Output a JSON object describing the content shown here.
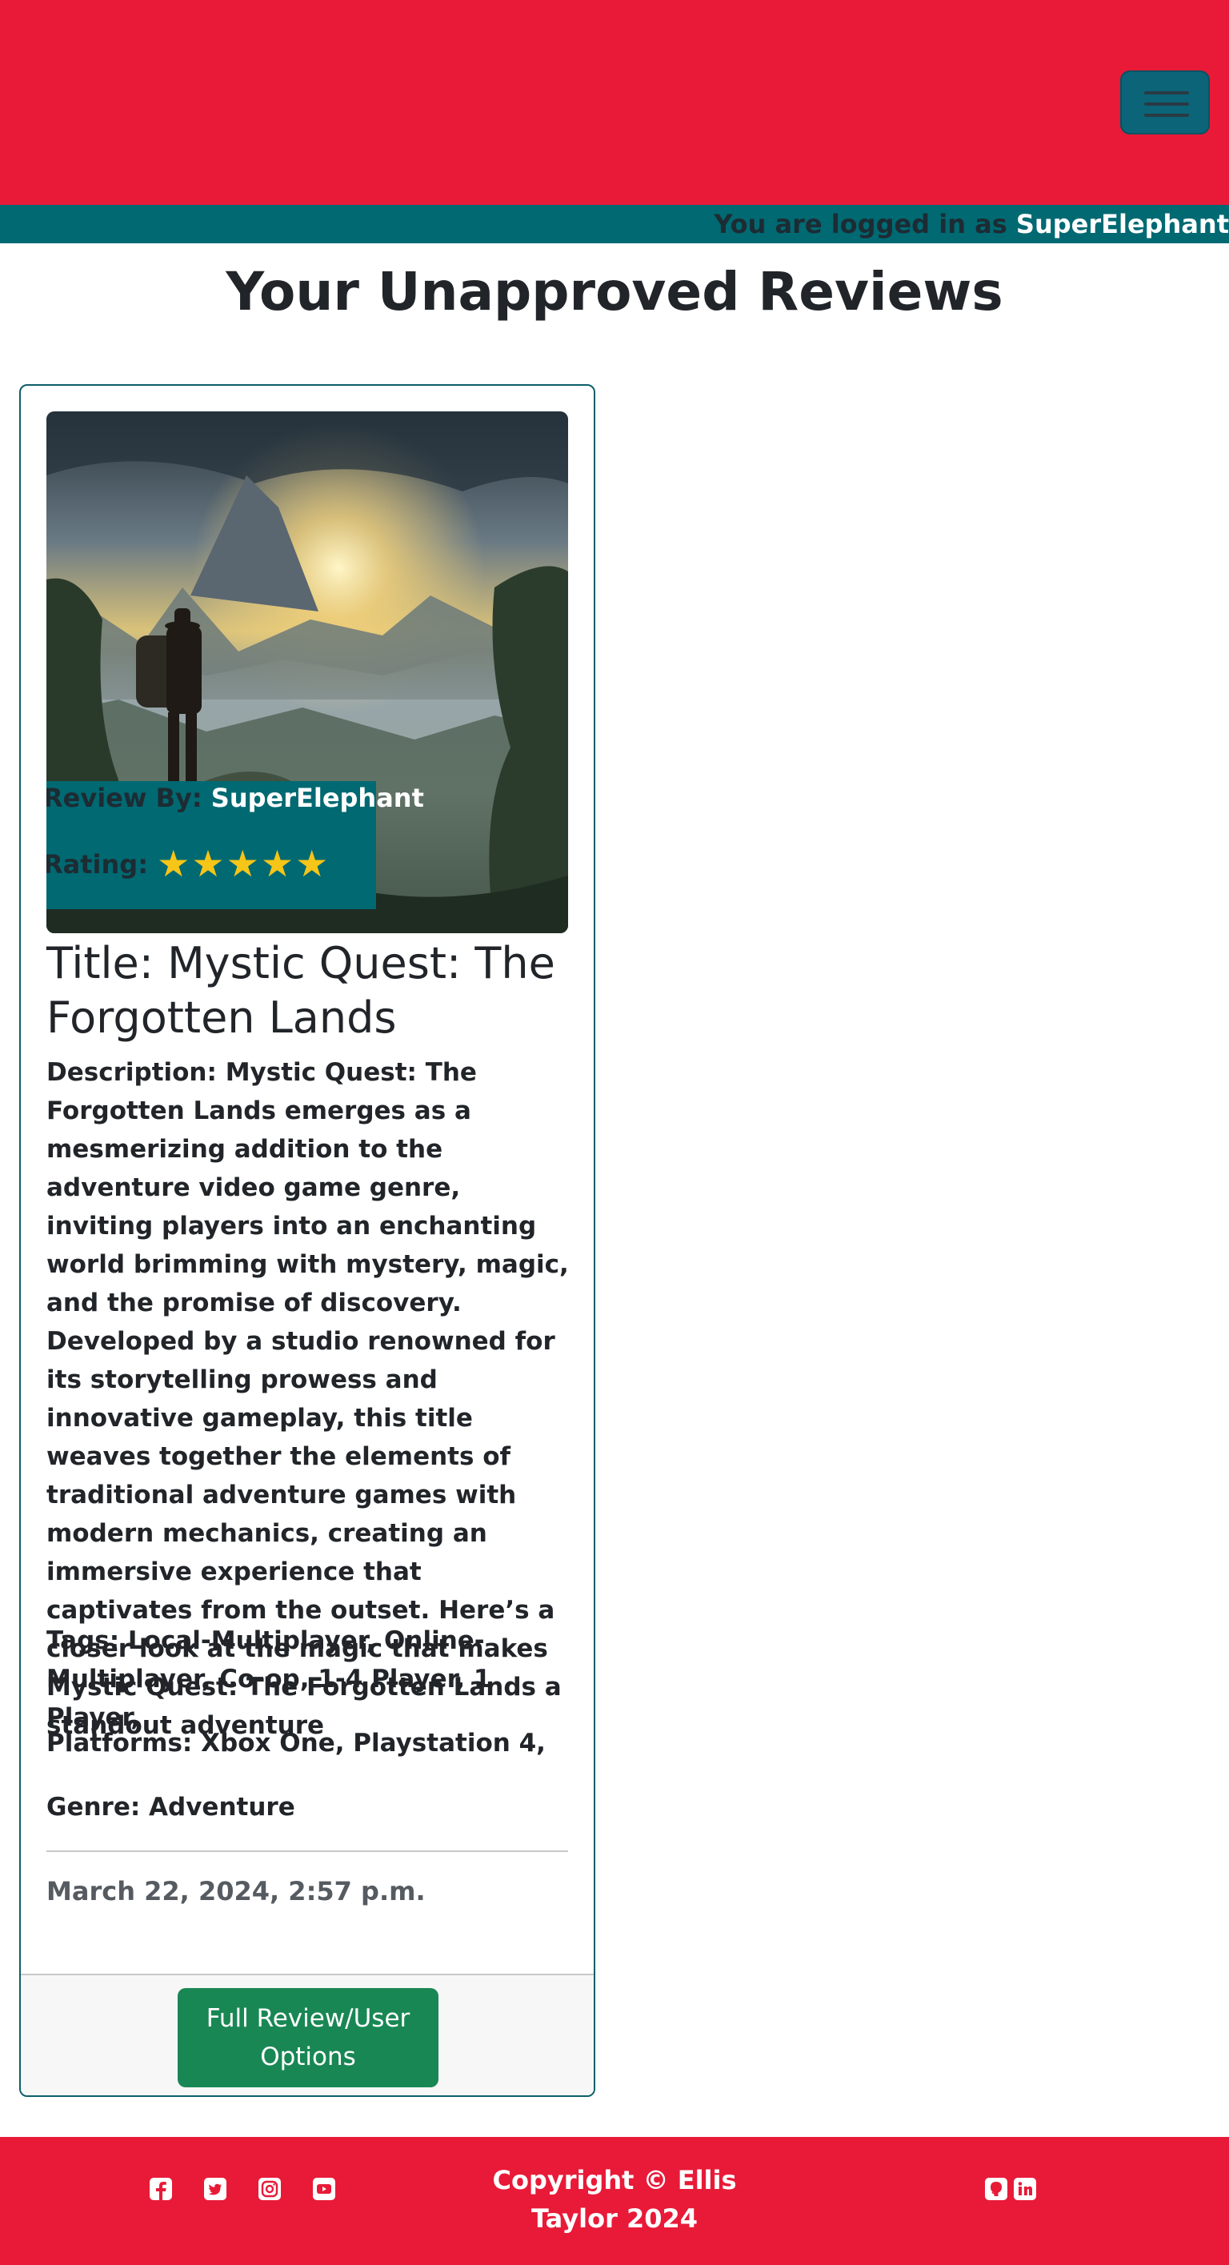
{
  "navbar": {
    "menu_toggle_icon": "hamburger-icon",
    "brand_color": "#e81a38",
    "toggle_color": "#0b6478"
  },
  "login_strip": {
    "prefix": "You are logged in as ",
    "username": "SuperElephant"
  },
  "page": {
    "title": "Your Unapproved Reviews"
  },
  "review": {
    "image_alt": "adventurer overlooking misty jungle valley at sunset",
    "review_by_label": "Review By: ",
    "review_by_user": "SuperElephant",
    "rating_label": "Rating: ",
    "rating_value": 5,
    "rating_max": 5,
    "rating_stars": "★★★★★",
    "title": "Title: Mystic Quest: The Forgotten Lands",
    "description": "Description: Mystic Quest: The Forgotten Lands emerges as a mesmerizing addition to the adventure video game genre, inviting players into an enchanting world brimming with mystery, magic, and the promise of discovery. Developed by a studio renowned for its storytelling prowess and innovative gameplay, this title weaves together the elements of traditional adventure games with modern mechanics, creating an immersive experience that captivates from the outset. Here’s a closer look at the magic that makes Mystic Quest: The Forgotten Lands a standout adventure",
    "tags": "Tags: Local-Multiplayer, Online-Multiplayer, Co-op, 1-4 Player, 1 Player,",
    "platforms": "Platforms: Xbox One, Playstation 4,",
    "genre": "Genre: Adventure",
    "date": "March 22, 2024, 2:57 p.m.",
    "button_label": "Full Review/User Options"
  },
  "footer": {
    "social_icons": [
      "facebook-icon",
      "twitter-icon",
      "instagram-icon",
      "youtube-icon"
    ],
    "copyright": "Copyright © Ellis Taylor 2024",
    "dev_icons": [
      "github-icon",
      "linkedin-icon"
    ]
  }
}
